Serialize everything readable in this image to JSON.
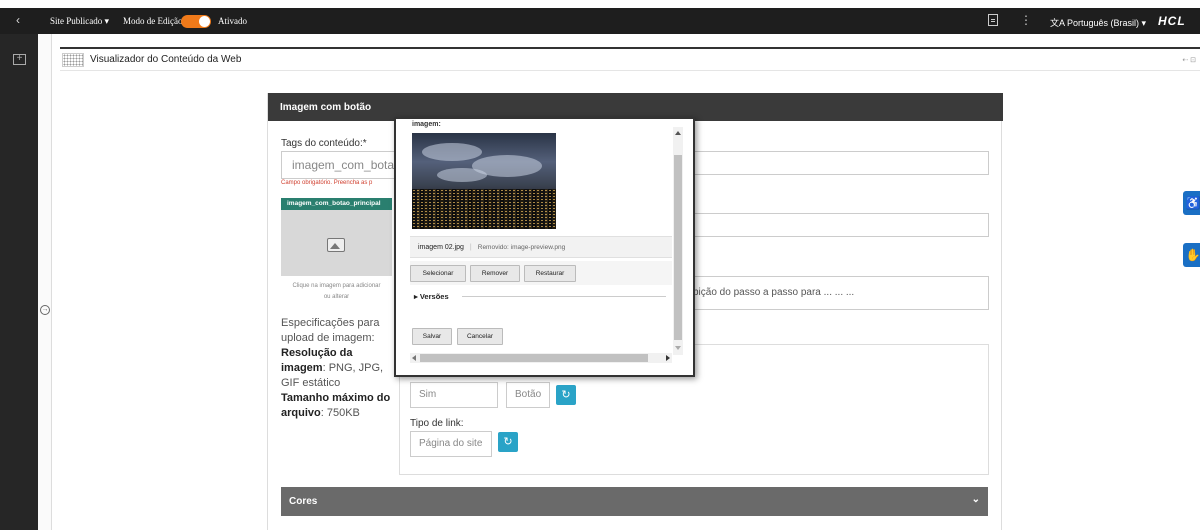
{
  "topbar": {
    "back_glyph": "‹",
    "site_label": "Site Publicado ▾",
    "edit_mode_label": "Modo de Edição:",
    "edit_mode_state": "Ativado",
    "edit_mode_on": true,
    "kebab_glyph": "⋮",
    "language": "文A Português (Brasil) ▾",
    "brand": "HCL"
  },
  "viewer": {
    "title": "Visualizador do Conteúdo da Web",
    "right_icons": "⇠ ⊡"
  },
  "card": {
    "title": "Imagem com botão",
    "tags_label": "Tags do conteúdo:*",
    "tags_value": "imagem_com_botao",
    "required_msg": "Campo obrigatório. Preencha as p",
    "step_text": "bição do passo a passo para ... ... ...",
    "image_badge": "imagem_com_botao_principal",
    "image_hint_1": "Clique na imagem para adicionar",
    "image_hint_2": "ou alterar",
    "specs": {
      "intro": "Especificações para upload de imagem:",
      "res_label": "Resolução da imagem",
      "res_value": ": PNG, JPG, GIF estático",
      "size_label": "Tamanho máximo do arquivo",
      "size_value": ": 750KB"
    },
    "sim_value": "Sim",
    "botao_value": "Botão",
    "link_type_label": "Tipo de link:",
    "link_type_value": "Página do site",
    "refresh_glyph": "↻",
    "cores_label": "Cores",
    "cores_chevron": "⌄"
  },
  "modal": {
    "cut_label": "imagem:",
    "filename": "imagem 02.jpg",
    "removed": "Removido: image-preview.png",
    "btn_select": "Selecionar",
    "btn_remove": "Remover",
    "btn_restore": "Restaurar",
    "versions": "▸ Versões",
    "btn_save": "Salvar",
    "btn_cancel": "Cancelar"
  },
  "side": {
    "accessibility_glyph": "♿",
    "sign_glyph": "✋"
  }
}
